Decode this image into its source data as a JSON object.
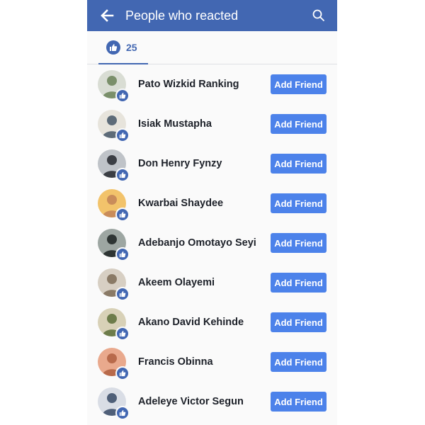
{
  "header": {
    "title": "People who reacted",
    "back_icon": "arrow-left-icon",
    "search_icon": "search-icon"
  },
  "tabs": {
    "like_count": "25",
    "like_icon": "thumbs-up-icon"
  },
  "people": [
    {
      "name": "Pato Wizkid Ranking",
      "button": "Add Friend",
      "avatar_colors": [
        "#7a8f6a",
        "#d9ddd4"
      ]
    },
    {
      "name": "Isiak Mustapha",
      "button": "Add Friend",
      "avatar_colors": [
        "#5d6b78",
        "#e7e4dc"
      ]
    },
    {
      "name": "Don Henry Fynzy",
      "button": "Add Friend",
      "avatar_colors": [
        "#3b3e44",
        "#bfc3c8"
      ]
    },
    {
      "name": "Kwarbai Shaydee",
      "button": "Add Friend",
      "avatar_colors": [
        "#c98c5a",
        "#f2c36b"
      ]
    },
    {
      "name": "Adebanjo Omotayo Seyi",
      "button": "Add Friend",
      "avatar_colors": [
        "#2e3534",
        "#9da6a2"
      ]
    },
    {
      "name": "Akeem Olayemi",
      "button": "Add Friend",
      "avatar_colors": [
        "#8a7a66",
        "#d7cfc3"
      ]
    },
    {
      "name": "Akano David Kehinde",
      "button": "Add Friend",
      "avatar_colors": [
        "#6d7c4a",
        "#d8d1b7"
      ]
    },
    {
      "name": "Francis Obinna",
      "button": "Add Friend",
      "avatar_colors": [
        "#b86a4b",
        "#e9a98d"
      ]
    },
    {
      "name": "Adeleye Victor Segun",
      "button": "Add Friend",
      "avatar_colors": [
        "#4f5f78",
        "#d9dde5"
      ]
    }
  ],
  "colors": {
    "brand_blue": "#4267b2",
    "button_blue": "#4c82ea",
    "name_text": "#1d2129"
  }
}
